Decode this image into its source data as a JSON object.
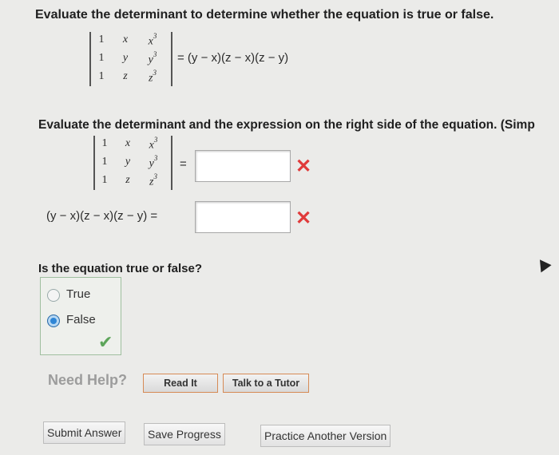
{
  "question": {
    "title": "Evaluate the determinant to determine whether the equation is true or false.",
    "matrix": [
      [
        "1",
        "x",
        "x",
        "3"
      ],
      [
        "1",
        "y",
        "y",
        "3"
      ],
      [
        "1",
        "z",
        "z",
        "3"
      ]
    ],
    "top_equation": "= (y − x)(z − x)(z − y)"
  },
  "part": {
    "instruction": "Evaluate the determinant and the expression on the right side of the equation. (Simp",
    "equals": "=",
    "expression": "(y − x)(z − x)(z − y) =",
    "determinant_value": "",
    "expression_value": "",
    "wrong_mark": "✕"
  },
  "tf": {
    "question": "Is the equation true or false?",
    "options": [
      "True",
      "False"
    ],
    "selected": "False",
    "check_mark": "✔"
  },
  "help": {
    "label": "Need Help?",
    "read_it": "Read It",
    "tutor": "Talk to a Tutor"
  },
  "actions": {
    "submit": "Submit Answer",
    "save": "Save Progress",
    "practice": "Practice Another Version"
  },
  "colors": {
    "wrong": "#e03a3a",
    "correct": "#5da55a",
    "radio_selected": "#2f86d6"
  }
}
